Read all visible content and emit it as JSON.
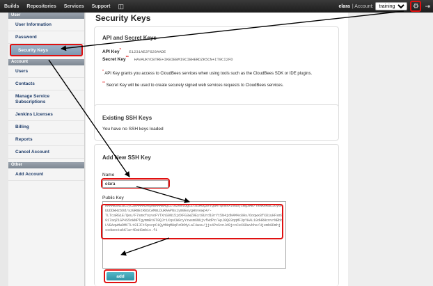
{
  "topbar": {
    "nav": [
      "Builds",
      "Repositories",
      "Services",
      "Support"
    ],
    "book_icon": "book-icon",
    "user": "elara",
    "account_label": "| Account:",
    "account_value": "training 2",
    "gear_icon": "gear-icon",
    "exit_icon": "exit-icon"
  },
  "sidebar": {
    "user_header": "User",
    "user_items": [
      "User Information",
      "Password",
      "Security Keys"
    ],
    "account_header": "Account",
    "account_items": [
      "Users",
      "Contacts",
      "Manage Service Subscriptions",
      "Jenkins Licenses",
      "Billing",
      "Reports",
      "Cancel Account"
    ],
    "other_header": "Other",
    "other_items": [
      "Add Account"
    ]
  },
  "page": {
    "title": "Security Keys"
  },
  "api_keys": {
    "title": "API and Secret Keys",
    "api_key_label": "API Key",
    "api_key_marker": "*",
    "api_key_value": "E1231AE2F629AADE",
    "secret_key_label": "Secret Key",
    "secret_key_marker": "**",
    "secret_key_value": "HAVAUKYCBTRE+IKBIEBMI9CIBHERDZK5CN+IT9CI2FD",
    "note1_marker": "*",
    "note1": "API Key grants you access to CloudBees services when using tools such as the CloudBees SDK or IDE plugins.",
    "note2_marker": "**",
    "note2": "Secret Key will be used to create securely signed web services requests to CloudBees services."
  },
  "ssh_existing": {
    "title": "Existing SSH Keys",
    "empty_text": "You have no SSH keys loaded"
  },
  "ssh_new": {
    "title": "Add New SSH Key",
    "name_label": "Name",
    "name_value": "elara",
    "public_key_label": "Public Key",
    "public_key_value": "AAAAB3NzaC1yc2EAAAADAQABAAABAQC1l6Ze8tUgCiluiHuQzE7QaM7qhmsXt0aSjIBg3AE/TENKeRaLJoyGrUUDDWHzbOd/szGRmEtR8SCAMmLDuRAAPNsiym0EeygHnvewp4/-TLTcaRGiE/Qeu/F7smxfoyvoFYTXnS0N15jdXFG3wZ9Eyt8Urd10rYt5N4jdN4M4x8Hs/Ooqwx8fX8iuHFsmS917aqZ1GP4S5oWNPTgymmBt0T0QJriXqsCW8cyYzwsm6NUjvfWdPz/ApJ0Q03qqMF3pYHAL10dHRHcnvrNBbbLVBAqwMwDMCTLt9IJFt5pscpCiQyMNqMHqPzOKMyLaI4wsu/jjs4PoSvnJd9jcoCeX6Dwvbhe/Hjemb8Dmhj ssdwestwkKlar4DaHSmbis.fi",
    "add_button": "add"
  }
}
